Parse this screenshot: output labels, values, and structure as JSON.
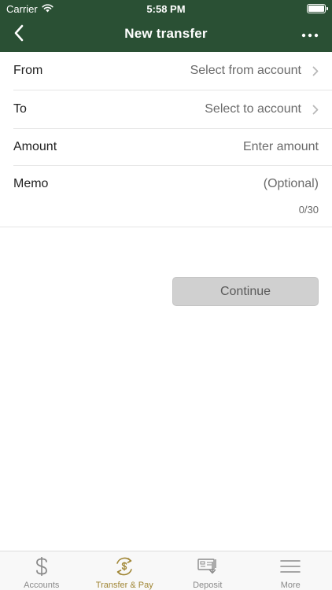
{
  "status_bar": {
    "carrier": "Carrier",
    "time": "5:58 PM"
  },
  "nav": {
    "title": "New transfer",
    "back_icon": "chevron-left-icon",
    "menu_icon": "more-horizontal-icon"
  },
  "form": {
    "from": {
      "label": "From",
      "value": "Select from account"
    },
    "to": {
      "label": "To",
      "value": "Select to account"
    },
    "amount": {
      "label": "Amount",
      "placeholder": "Enter amount"
    },
    "memo": {
      "label": "Memo",
      "placeholder": "(Optional)",
      "counter": "0/30"
    }
  },
  "continue_label": "Continue",
  "tabs": [
    {
      "label": "Accounts",
      "icon": "dollar-icon",
      "active": false
    },
    {
      "label": "Transfer & Pay",
      "icon": "transfer-pay-icon",
      "active": true
    },
    {
      "label": "Deposit",
      "icon": "check-deposit-icon",
      "active": false
    },
    {
      "label": "More",
      "icon": "menu-lines-icon",
      "active": false
    }
  ],
  "colors": {
    "header": "#2a5034",
    "accent": "#a08635",
    "inactive_tab": "#8a8a8a",
    "button_disabled": "#d0d0d0"
  }
}
